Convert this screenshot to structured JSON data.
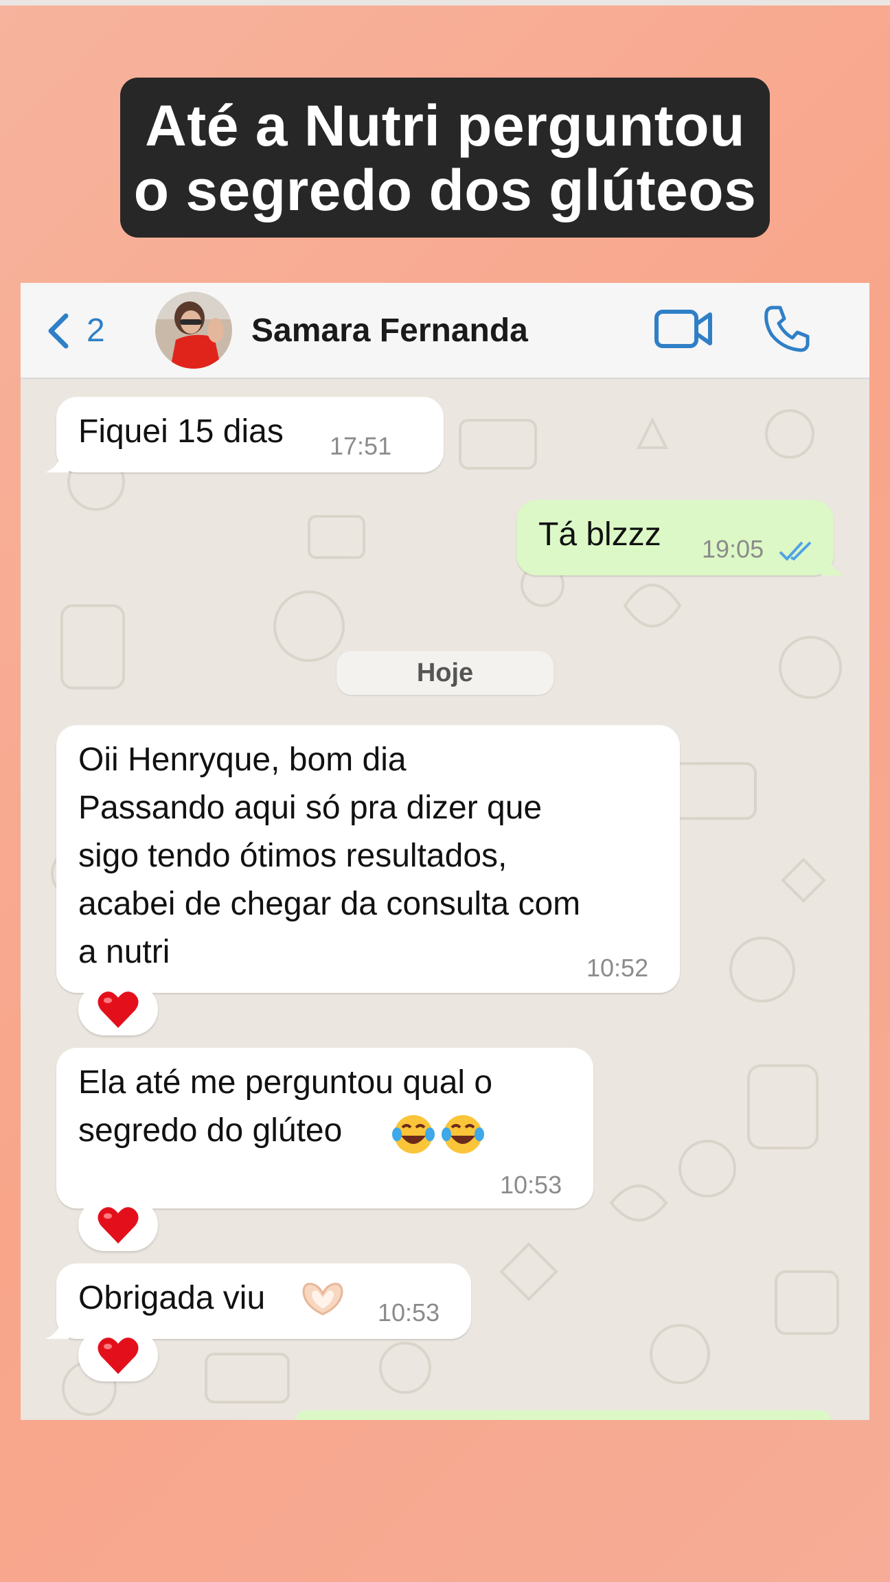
{
  "headline": {
    "line1": "Até a Nutri perguntou",
    "line2": "o segredo dos glúteos"
  },
  "header": {
    "back_icon": "chevron-left-icon",
    "back_count": "2",
    "contact_name": "Samara Fernanda",
    "video_icon": "video-camera-icon",
    "call_icon": "phone-icon",
    "accent_color": "#2f7fc7"
  },
  "day_separator": "Hoje",
  "messages": [
    {
      "direction": "in",
      "text": "Fiquei 15 dias",
      "time": "17:51"
    },
    {
      "direction": "out",
      "text": "Tá blzzz",
      "time": "19:05",
      "status": "read-double-check-icon"
    },
    {
      "direction": "in",
      "text": "Oii Henryque, bom dia\nPassando aqui só pra dizer que\nsigo tendo ótimos resultados,\nacabei de chegar da consulta com\na nutri",
      "time": "10:52",
      "reaction": "heart-emoji"
    },
    {
      "direction": "in",
      "text": "Ela até me perguntou qual o\nsegredo do glúteo",
      "emojis": [
        "laughing-tears-emoji",
        "laughing-tears-emoji"
      ],
      "time": "10:53",
      "reaction": "heart-emoji"
    },
    {
      "direction": "in",
      "text": "Obrigada viu",
      "emojis": [
        "heart-hands-emoji"
      ],
      "time": "10:53",
      "reaction": "heart-emoji"
    }
  ],
  "colors": {
    "incoming_bubble": "#ffffff",
    "outgoing_bubble": "#dcf8c6",
    "background": "#f8a58a",
    "headline_box": "#272727"
  }
}
